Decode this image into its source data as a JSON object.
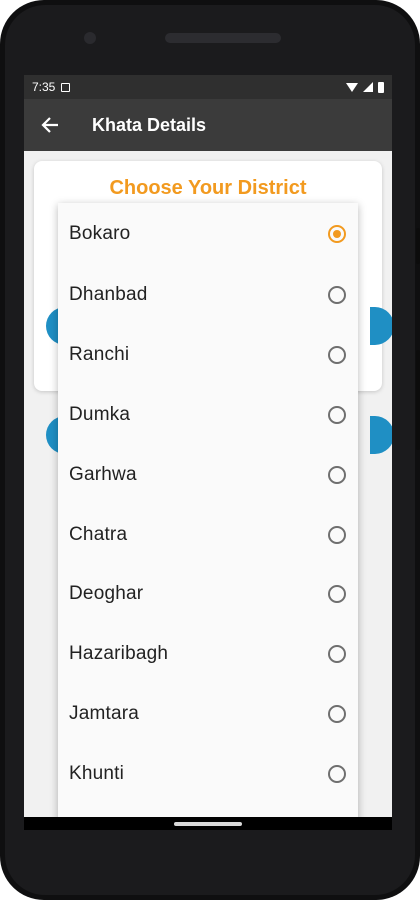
{
  "status_bar": {
    "time": "7:35"
  },
  "app_bar": {
    "title": "Khata Details"
  },
  "card": {
    "title": "Choose Your District"
  },
  "district_list": {
    "options": [
      {
        "label": "Bokaro",
        "selected": true
      },
      {
        "label": "Dhanbad",
        "selected": false
      },
      {
        "label": "Ranchi",
        "selected": false
      },
      {
        "label": "Dumka",
        "selected": false
      },
      {
        "label": "Garhwa",
        "selected": false
      },
      {
        "label": "Chatra",
        "selected": false
      },
      {
        "label": "Deoghar",
        "selected": false
      },
      {
        "label": "Hazaribagh",
        "selected": false
      },
      {
        "label": "Jamtara",
        "selected": false
      },
      {
        "label": "Khunti",
        "selected": false
      }
    ]
  },
  "colors": {
    "accent": "#f29a1f",
    "toolbar": "#3b3b3b",
    "button_blue": "#1f8fc4"
  }
}
